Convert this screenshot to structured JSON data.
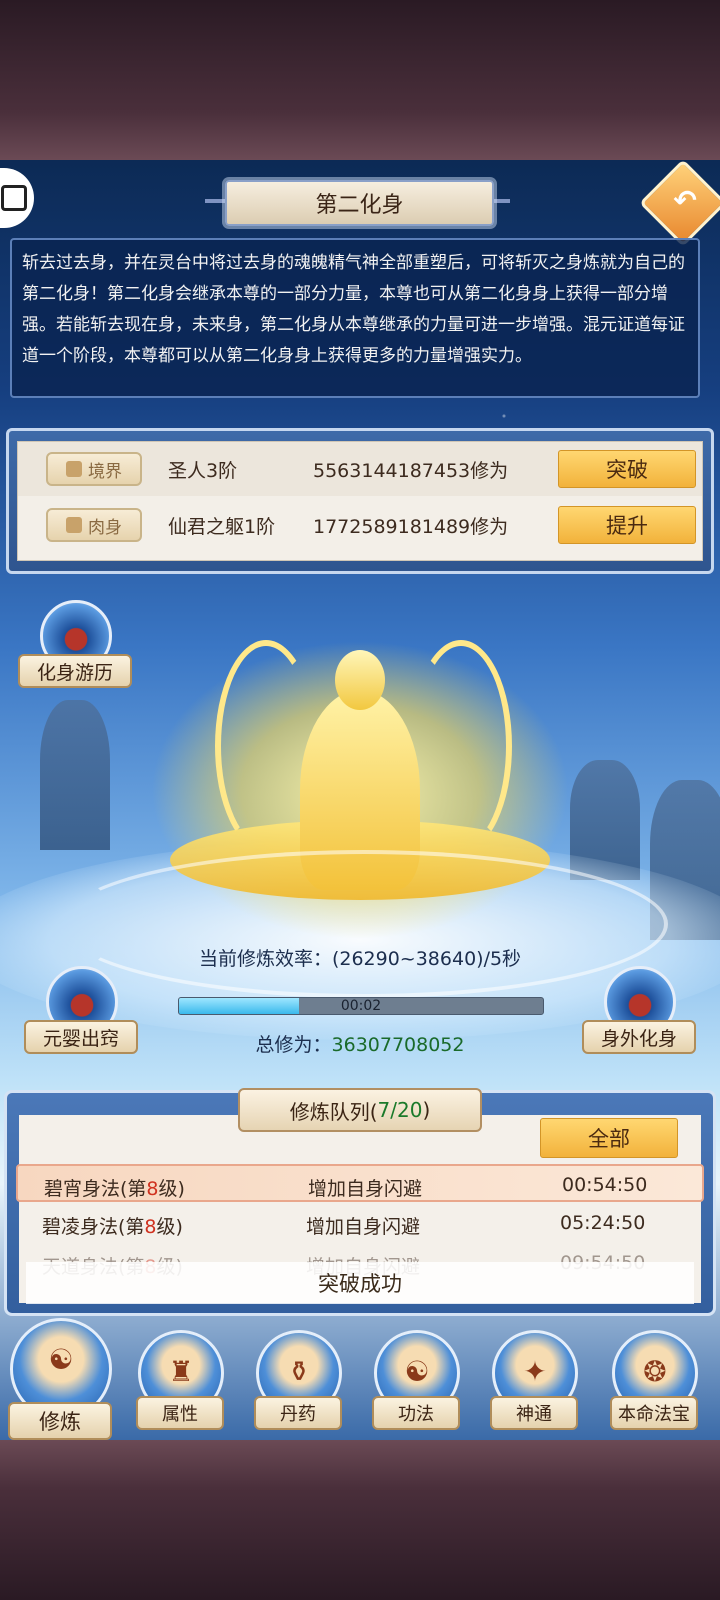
{
  "header": {
    "title": "第二化身",
    "back_icon": "back-arrow-icon",
    "frame_icon": "screenshot-frame-icon"
  },
  "description": "斩去过去身，并在灵台中将过去身的魂魄精气神全部重塑后，可将斩灭之身炼就为自己的第二化身！第二化身会继承本尊的一部分力量，本尊也可从第二化身身上获得一部分增强。若能斩去现在身，未来身，第二化身从本尊继承的力量可进一步增强。混元证道每证道一个阶段，本尊都可以从第二化身身上获得更多的力量增强实力。",
  "stats": [
    {
      "tag": "境界",
      "tag_icon": "crown-icon",
      "level": "圣人3阶",
      "points": "5563144187453修为",
      "action": "突破"
    },
    {
      "tag": "肉身",
      "tag_icon": "flame-icon",
      "level": "仙君之躯1阶",
      "points": "1772589181489修为",
      "action": "提升"
    }
  ],
  "side_buttons": {
    "travel": "化身游历",
    "yuanying": "元婴出窍",
    "outer": "身外化身"
  },
  "cultivation": {
    "efficiency": "当前修炼效率：(26290~38640)/5秒",
    "timer": "00:02",
    "progress": 0.33,
    "total_label": "总修为：",
    "total_value": "36307708052"
  },
  "queue": {
    "title": "修炼队列(",
    "count": "7/20",
    "title_end": " )",
    "all_button": "全部",
    "rows": [
      {
        "name": "碧宵身法(第",
        "level": "8",
        "suffix": "级)",
        "effect": "增加自身闪避",
        "time": "00:54:50"
      },
      {
        "name": "碧凌身法(第",
        "level": "8",
        "suffix": "级)",
        "effect": "增加自身闪避",
        "time": "05:24:50"
      },
      {
        "name": "天道身法(第",
        "level": "8",
        "suffix": "级)",
        "effect": "增加自身闪避",
        "time": "09:54:50"
      }
    ],
    "toast": "突破成功"
  },
  "nav": [
    {
      "label": "修炼",
      "icon": "meditation-icon",
      "glyph": "☯"
    },
    {
      "label": "属性",
      "icon": "attribute-icon",
      "glyph": "♜"
    },
    {
      "label": "丹药",
      "icon": "pill-cauldron-icon",
      "glyph": "⚱"
    },
    {
      "label": "功法",
      "icon": "scroll-icon",
      "glyph": "☯"
    },
    {
      "label": "神通",
      "icon": "book-icon",
      "glyph": "✦"
    },
    {
      "label": "本命法宝",
      "icon": "treasure-icon",
      "glyph": "❂"
    }
  ]
}
